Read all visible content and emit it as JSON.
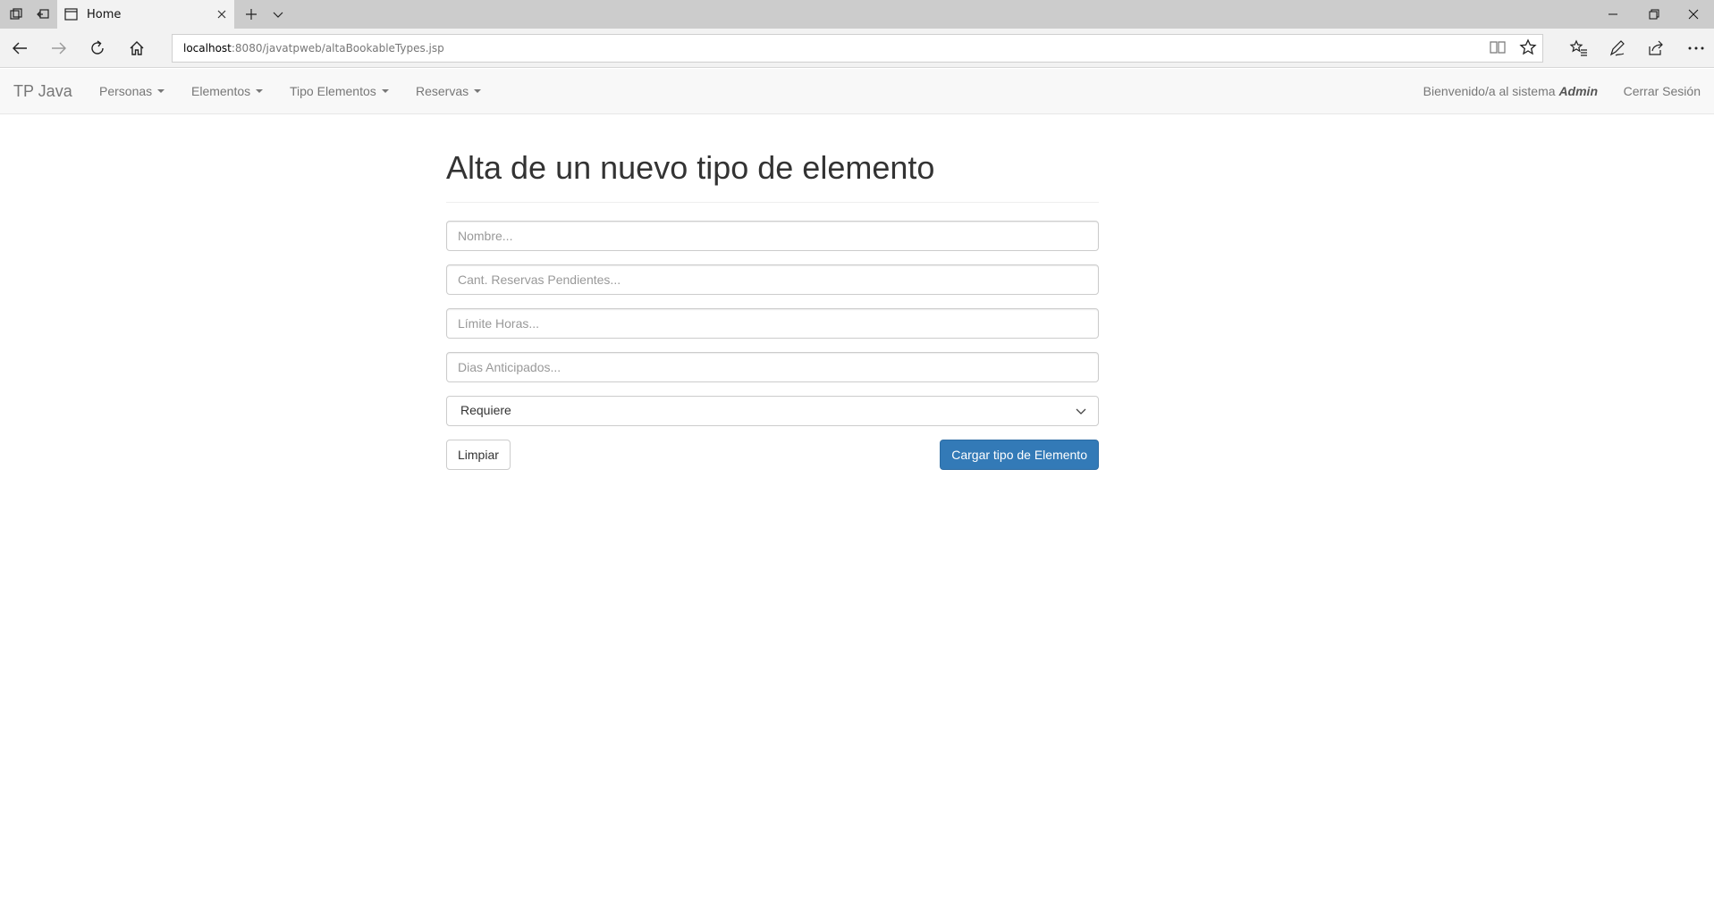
{
  "browser": {
    "tab_title": "Home",
    "url_host": "localhost",
    "url_rest": ":8080/javatpweb/altaBookableTypes.jsp"
  },
  "navbar": {
    "brand": "TP Java",
    "items": [
      {
        "label": "Personas"
      },
      {
        "label": "Elementos"
      },
      {
        "label": "Tipo Elementos"
      },
      {
        "label": "Reservas"
      }
    ],
    "welcome_text": "Bienvenido/a al sistema",
    "user_name": "Admin",
    "logout_label": "Cerrar Sesión"
  },
  "form": {
    "title": "Alta de un nuevo tipo de elemento",
    "fields": [
      {
        "placeholder": "Nombre...",
        "value": ""
      },
      {
        "placeholder": "Cant. Reservas Pendientes...",
        "value": ""
      },
      {
        "placeholder": "Límite Horas...",
        "value": ""
      },
      {
        "placeholder": "Dias Anticipados...",
        "value": ""
      }
    ],
    "select_value": "Requiere",
    "clear_label": "Limpiar",
    "submit_label": "Cargar tipo de Elemento"
  },
  "colors": {
    "primary": "#337ab7",
    "navbar_bg": "#f8f8f8",
    "chrome_bg": "#cccccc"
  }
}
